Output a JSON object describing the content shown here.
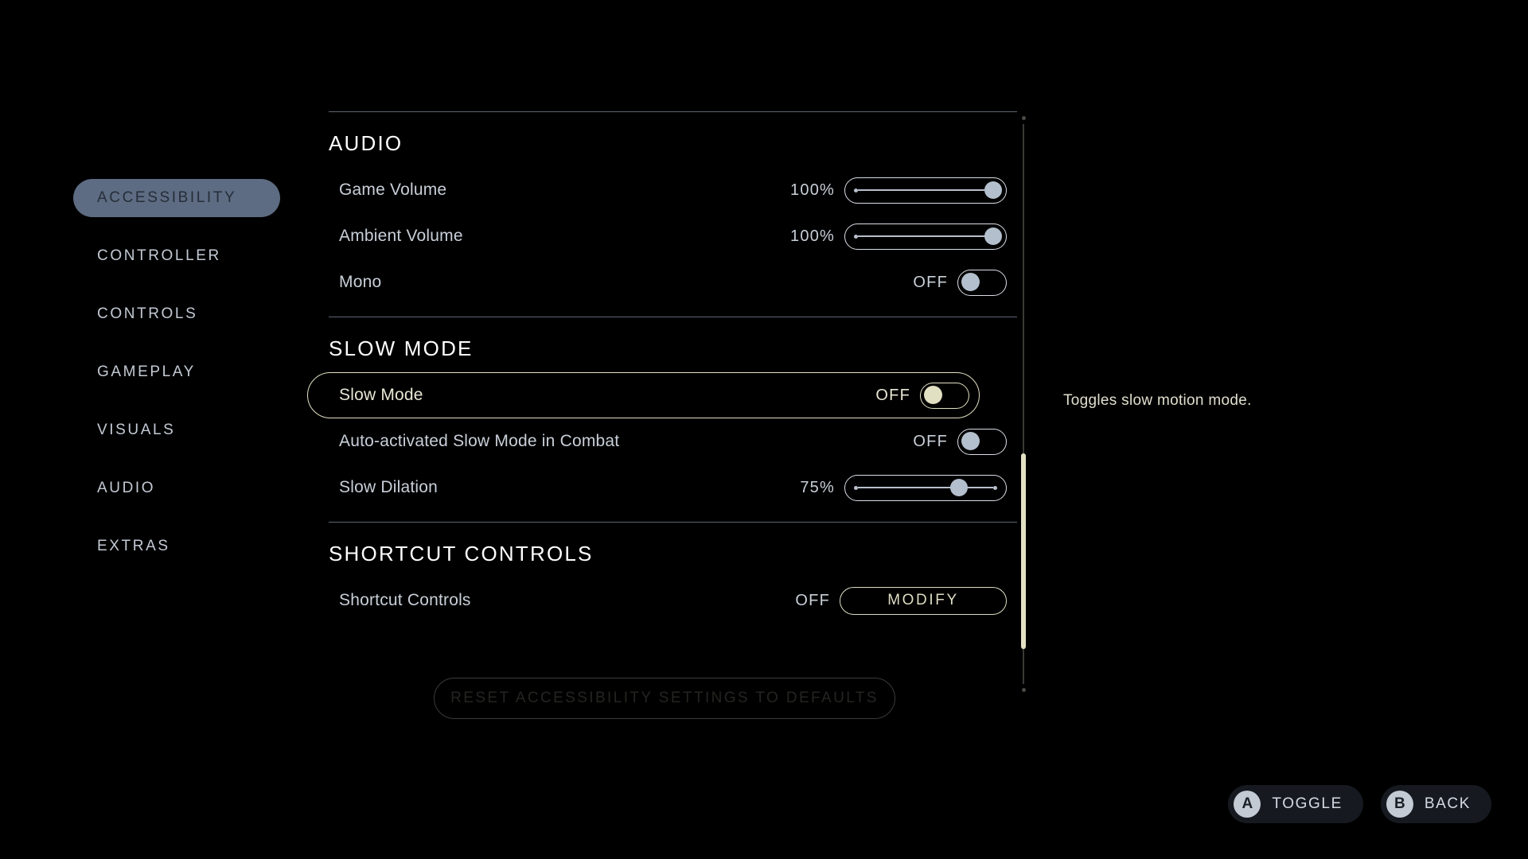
{
  "sidebar": {
    "items": [
      {
        "label": "ACCESSIBILITY",
        "selected": true
      },
      {
        "label": "CONTROLLER",
        "selected": false
      },
      {
        "label": "CONTROLS",
        "selected": false
      },
      {
        "label": "GAMEPLAY",
        "selected": false
      },
      {
        "label": "VISUALS",
        "selected": false
      },
      {
        "label": "AUDIO",
        "selected": false
      },
      {
        "label": "EXTRAS",
        "selected": false
      }
    ]
  },
  "sections": {
    "audio": {
      "title": "AUDIO",
      "rows": {
        "game_volume": {
          "label": "Game Volume",
          "value": "100%"
        },
        "ambient_volume": {
          "label": "Ambient Volume",
          "value": "100%"
        },
        "mono": {
          "label": "Mono",
          "value": "OFF"
        }
      }
    },
    "slow_mode": {
      "title": "SLOW MODE",
      "rows": {
        "slow_mode": {
          "label": "Slow Mode",
          "value": "OFF"
        },
        "auto_slow_mode": {
          "label": "Auto-activated Slow Mode in Combat",
          "value": "OFF"
        },
        "slow_dilation": {
          "label": "Slow Dilation",
          "value": "75%"
        }
      }
    },
    "shortcut_controls": {
      "title": "SHORTCUT CONTROLS",
      "rows": {
        "shortcut_controls": {
          "label": "Shortcut Controls",
          "value": "OFF",
          "button_label": "MODIFY"
        }
      }
    }
  },
  "reset_button": {
    "label": "RESET ACCESSIBILITY SETTINGS TO DEFAULTS"
  },
  "tooltip": {
    "text": "Toggles slow motion mode."
  },
  "prompts": [
    {
      "button": "A",
      "label": "TOGGLE"
    },
    {
      "button": "B",
      "label": "BACK"
    }
  ],
  "colors": {
    "background": "#000000",
    "selected_pill": "#5D6C82",
    "selected_text": "#262D39",
    "nav_text": "#C3CAD4",
    "focus_accent": "#E3E1C4",
    "knob": "#B3BFCD",
    "section_title": "#FFFFFF",
    "row_label": "#C8CFD8"
  }
}
